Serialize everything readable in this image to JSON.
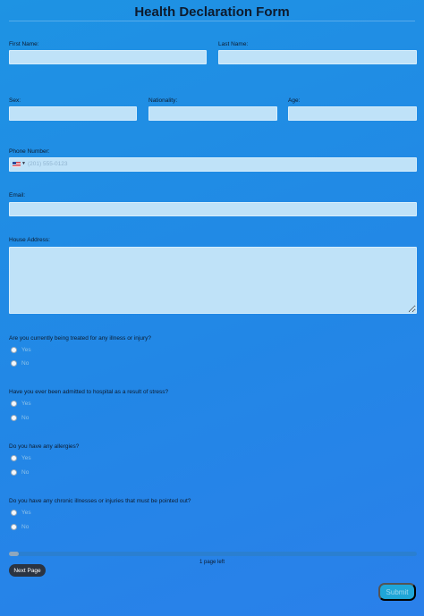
{
  "form": {
    "title": "Health Declaration Form",
    "fields": {
      "first_name": {
        "label": "First Name:",
        "value": ""
      },
      "last_name": {
        "label": "Last Name:",
        "value": ""
      },
      "sex": {
        "label": "Sex:",
        "value": ""
      },
      "nationality": {
        "label": "Nationality:",
        "value": ""
      },
      "age": {
        "label": "Age:",
        "value": ""
      },
      "phone": {
        "label": "Phone Number:",
        "placeholder": "(201) 555-0123",
        "country_icon": "us-flag-icon"
      },
      "email": {
        "label": "Email:",
        "value": ""
      },
      "address": {
        "label": "House Address:",
        "value": ""
      }
    },
    "questions": [
      {
        "text": "Are you currently being treated for any illness or injury?",
        "options": [
          "Yes",
          "No"
        ]
      },
      {
        "text": "Have you ever been admitted to hospital as a result of stress?",
        "options": [
          "Yes",
          "No"
        ]
      },
      {
        "text": "Do you have any allergies?",
        "options": [
          "Yes",
          "No"
        ]
      },
      {
        "text": "Do you have any chronic illnesses or injuries that must be pointed out?",
        "options": [
          "Yes",
          "No"
        ]
      }
    ],
    "progress": {
      "fraction": 0.025,
      "pages_left_text": "1 page left"
    },
    "buttons": {
      "next_page": "Next Page",
      "submit": "Submit"
    }
  }
}
